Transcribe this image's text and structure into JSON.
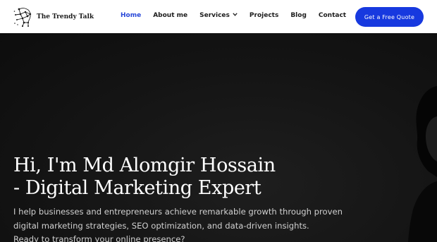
{
  "brand": {
    "name": "The Trendy Talk",
    "logo_icon": "network-head-logo"
  },
  "nav": {
    "items": [
      {
        "label": "Home",
        "active": true
      },
      {
        "label": "About me"
      },
      {
        "label": "Services",
        "has_dropdown": true
      },
      {
        "label": "Projects"
      },
      {
        "label": "Blog"
      },
      {
        "label": "Contact"
      }
    ],
    "cta_label": "Get a Free Quote"
  },
  "hero": {
    "title_line1": "Hi, I'm Md Alomgir Hossain",
    "title_line2": "- Digital Marketing Expert",
    "text_line1": "I help businesses and entrepreneurs achieve remarkable growth through proven",
    "text_line2": "digital marketing strategies, SEO optimization, and data-driven insights.",
    "text_line3": "Ready to transform your online presence?"
  },
  "colors": {
    "accent": "#1739df",
    "active_nav": "#2747d8",
    "hero_bg": "#121212",
    "header_bg": "#ffffff"
  }
}
